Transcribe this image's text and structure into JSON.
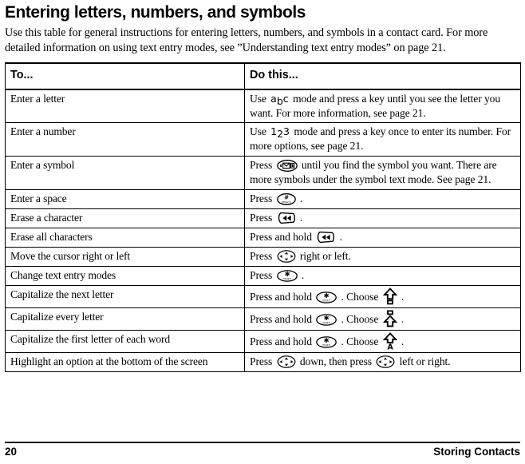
{
  "document": {
    "title": "Entering letters, numbers, and symbols",
    "intro": "Use this table for general instructions for entering letters, numbers, and symbols in a contact card. For more detailed information on using text entry modes, see ”Understanding text entry modes” on page 21."
  },
  "table": {
    "headers": {
      "col1": "To...",
      "col2": "Do this..."
    },
    "rows": [
      {
        "to": "Enter a letter",
        "pre": "Use",
        "icon": "abc-mode-glyph",
        "post": "mode and press a key until you see the letter you want. For more information, see page 21."
      },
      {
        "to": "Enter a number",
        "pre": "Use",
        "icon": "123-mode-glyph",
        "post": "mode and press a key once to enter its number. For more options, see page 21."
      },
      {
        "to": "Enter a symbol",
        "pre": "Press",
        "icon": "message-key-icon",
        "post": "until you find the symbol you want. There are more symbols under the symbol text mode. See page 21."
      },
      {
        "to": "Enter a space",
        "pre": "Press",
        "icon": "space-key-icon",
        "post": "."
      },
      {
        "to": "Erase a character",
        "pre": "Press",
        "icon": "back-key-icon",
        "post": "."
      },
      {
        "to": "Erase all characters",
        "pre": "Press and hold",
        "icon": "back-key-icon",
        "post": "."
      },
      {
        "to": "Move the cursor right or left",
        "pre": "Press",
        "icon": "navigation-key-icon",
        "post": "right or left."
      },
      {
        "to": "Change text entry modes",
        "pre": "Press",
        "icon": "text-key-icon",
        "post": "."
      },
      {
        "to": "Capitalize the next letter",
        "pre": "Press and hold",
        "icon": "text-key-icon",
        "mid": ". Choose",
        "icon2": "shift-once-icon",
        "post": "."
      },
      {
        "to": "Capitalize every letter",
        "pre": "Press and hold",
        "icon": "text-key-icon",
        "mid": ". Choose",
        "icon2": "caps-lock-icon",
        "post": "."
      },
      {
        "to": "Capitalize the first letter of each word",
        "pre": "Press and hold",
        "icon": "text-key-icon",
        "mid": ". Choose",
        "icon2": "sentence-case-icon",
        "post": "."
      },
      {
        "to": "Highlight an option at the bottom of the screen",
        "pre": "Press",
        "icon": "navigation-key-icon",
        "mid": "down, then press",
        "icon2": "navigation-key-icon",
        "post": "left or right."
      }
    ]
  },
  "footer": {
    "page_number": "20",
    "section": "Storing Contacts"
  },
  "glyphs": {
    "abc": {
      "a": "a",
      "b": "b",
      "c": "c"
    },
    "num": {
      "one": "1",
      "two": "2",
      "three": "3"
    },
    "space_label": "SPACE",
    "text_label": "TEXT",
    "sentence_letter": "A"
  },
  "colors": {
    "ink": "#000000",
    "paper": "#ffffff"
  }
}
